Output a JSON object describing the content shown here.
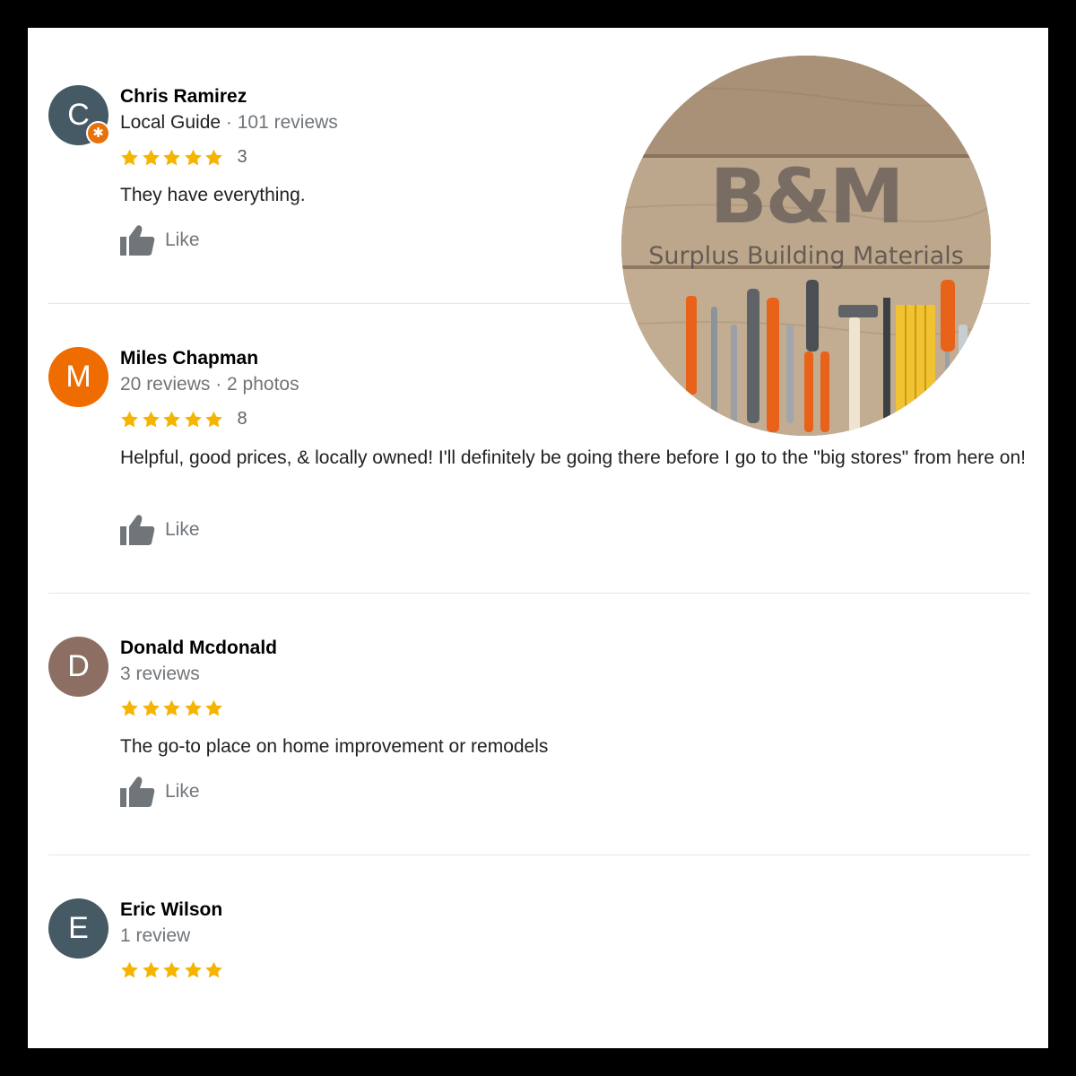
{
  "like_label": "Like",
  "colors": {
    "star": "#f5b400",
    "avatar_c": "#455a64",
    "avatar_m": "#ef6c00",
    "avatar_d": "#8d6e63",
    "avatar_e": "#455a64"
  },
  "logo": {
    "title": "B&M",
    "subtitle": "Surplus Building Materials"
  },
  "reviews": [
    {
      "initial": "C",
      "name": "Chris Ramirez",
      "badge": "Local Guide",
      "meta": "101 reviews",
      "stars": 5,
      "time": "3",
      "text": "They have everything."
    },
    {
      "initial": "M",
      "name": "Miles Chapman",
      "meta": "20 reviews · 2 photos",
      "stars": 5,
      "time": "8",
      "text": "Helpful, good prices, & locally owned! I'll definitely be going there before I go to the \"big stores\" from here on!"
    },
    {
      "initial": "D",
      "name": "Donald Mcdonald",
      "meta": "3 reviews",
      "stars": 5,
      "text": "The go-to place on home improvement or remodels"
    },
    {
      "initial": "E",
      "name": "Eric Wilson",
      "meta": "1 review",
      "stars": 5
    }
  ]
}
